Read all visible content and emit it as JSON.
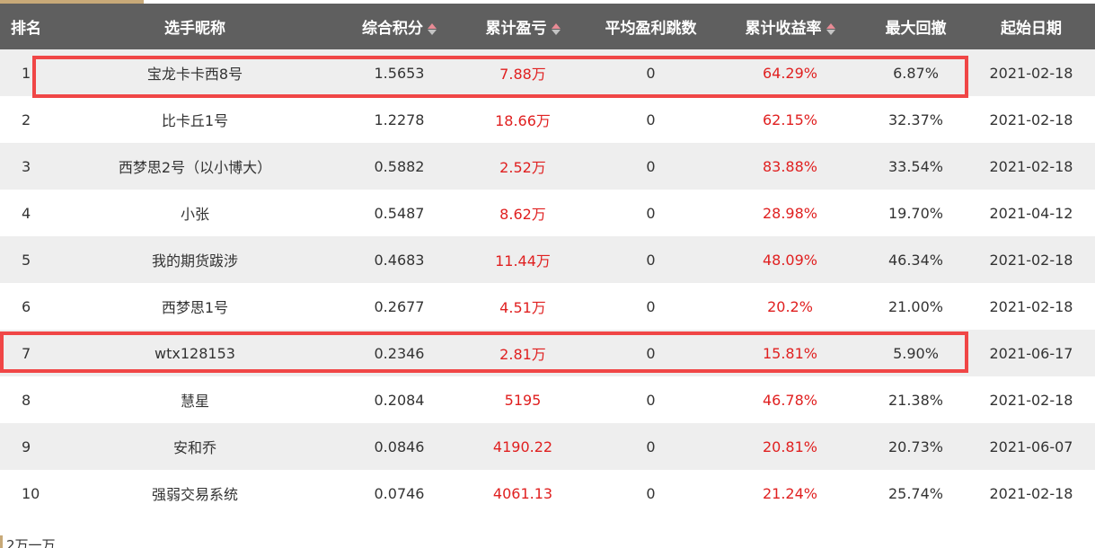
{
  "table": {
    "headers": {
      "rank": "排名",
      "name": "选手昵称",
      "score": "综合积分",
      "pnl": "累计盈亏",
      "avg_jumps": "平均盈利跳数",
      "return": "累计收益率",
      "drawdown": "最大回撤",
      "start": "起始日期"
    },
    "rows": [
      {
        "rank": "1",
        "name": "宝龙卡卡西8号",
        "score": "1.5653",
        "pnl": "7.88万",
        "avg_jumps": "0",
        "return": "64.29%",
        "drawdown": "6.87%",
        "start": "2021-02-18"
      },
      {
        "rank": "2",
        "name": "比卡丘1号",
        "score": "1.2278",
        "pnl": "18.66万",
        "avg_jumps": "0",
        "return": "62.15%",
        "drawdown": "32.37%",
        "start": "2021-02-18"
      },
      {
        "rank": "3",
        "name": "西梦思2号（以小博大）",
        "score": "0.5882",
        "pnl": "2.52万",
        "avg_jumps": "0",
        "return": "83.88%",
        "drawdown": "33.54%",
        "start": "2021-02-18"
      },
      {
        "rank": "4",
        "name": "小张",
        "score": "0.5487",
        "pnl": "8.62万",
        "avg_jumps": "0",
        "return": "28.98%",
        "drawdown": "19.70%",
        "start": "2021-04-12"
      },
      {
        "rank": "5",
        "name": "我的期货跋涉",
        "score": "0.4683",
        "pnl": "11.44万",
        "avg_jumps": "0",
        "return": "48.09%",
        "drawdown": "46.34%",
        "start": "2021-02-18"
      },
      {
        "rank": "6",
        "name": "西梦思1号",
        "score": "0.2677",
        "pnl": "4.51万",
        "avg_jumps": "0",
        "return": "20.2%",
        "drawdown": "21.00%",
        "start": "2021-02-18"
      },
      {
        "rank": "7",
        "name": "wtx128153",
        "score": "0.2346",
        "pnl": "2.81万",
        "avg_jumps": "0",
        "return": "15.81%",
        "drawdown": "5.90%",
        "start": "2021-06-17"
      },
      {
        "rank": "8",
        "name": "慧星",
        "score": "0.2084",
        "pnl": "5195",
        "avg_jumps": "0",
        "return": "46.78%",
        "drawdown": "21.38%",
        "start": "2021-02-18"
      },
      {
        "rank": "9",
        "name": "安和乔",
        "score": "0.0846",
        "pnl": "4190.22",
        "avg_jumps": "0",
        "return": "20.81%",
        "drawdown": "20.73%",
        "start": "2021-06-07"
      },
      {
        "rank": "10",
        "name": "强弱交易系统",
        "score": "0.0746",
        "pnl": "4061.13",
        "avg_jumps": "0",
        "return": "21.24%",
        "drawdown": "25.74%",
        "start": "2021-02-18"
      }
    ]
  },
  "footer": {
    "text": "2万一万"
  },
  "icons": {
    "sort": "sort-arrows-icon"
  },
  "colors": {
    "header_bg": "#5f5f5f",
    "highlight": "#f04646",
    "positive": "#e02020",
    "accent": "#c8a978"
  }
}
